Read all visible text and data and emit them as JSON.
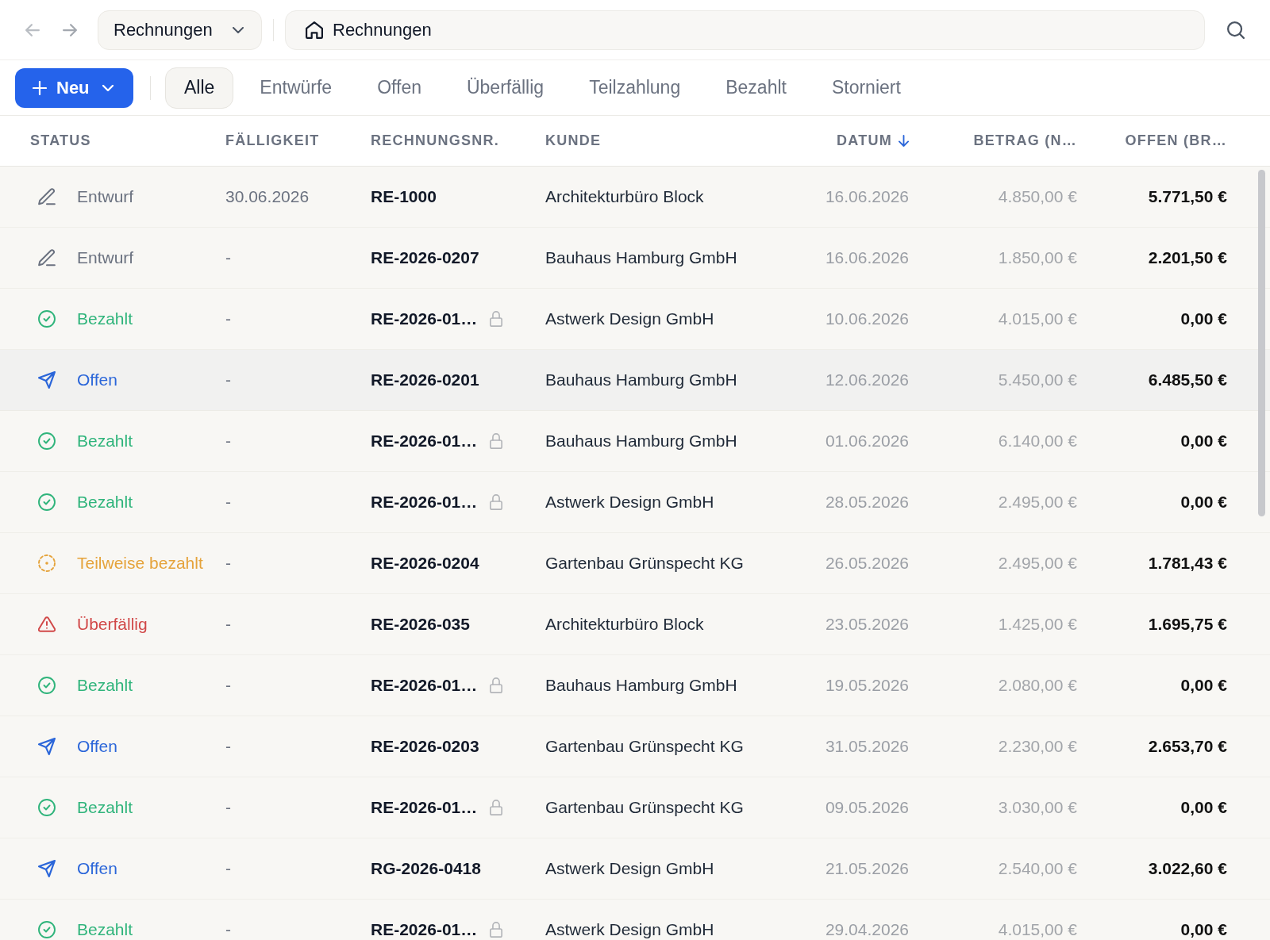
{
  "nav": {
    "section_dropdown": "Rechnungen",
    "breadcrumb": "Rechnungen"
  },
  "toolbar": {
    "new_button": "Neu",
    "tabs": [
      {
        "label": "Alle",
        "selected": true
      },
      {
        "label": "Entwürfe",
        "selected": false
      },
      {
        "label": "Offen",
        "selected": false
      },
      {
        "label": "Überfällig",
        "selected": false
      },
      {
        "label": "Teilzahlung",
        "selected": false
      },
      {
        "label": "Bezahlt",
        "selected": false
      },
      {
        "label": "Storniert",
        "selected": false
      }
    ]
  },
  "table": {
    "columns": [
      {
        "label": "STATUS",
        "sorted": false
      },
      {
        "label": "FÄLLIGKEIT",
        "sorted": false
      },
      {
        "label": "RECHNUNGSNR.",
        "sorted": false
      },
      {
        "label": "KUNDE",
        "sorted": false
      },
      {
        "label": "DATUM",
        "sorted": true
      },
      {
        "label": "BETRAG (N…",
        "sorted": false
      },
      {
        "label": "OFFEN (BR…",
        "sorted": false
      }
    ],
    "rows": [
      {
        "status": {
          "kind": "draft",
          "label": "Entwurf"
        },
        "due": "30.06.2026",
        "number": "RE-1000",
        "locked": false,
        "customer": "Architekturbüro Block",
        "date": "16.06.2026",
        "net": "4.850,00 €",
        "open": "5.771,50 €",
        "hovered": false
      },
      {
        "status": {
          "kind": "draft",
          "label": "Entwurf"
        },
        "due": "-",
        "number": "RE-2026-0207",
        "locked": false,
        "customer": "Bauhaus Hamburg GmbH",
        "date": "16.06.2026",
        "net": "1.850,00 €",
        "open": "2.201,50 €",
        "hovered": false
      },
      {
        "status": {
          "kind": "paid",
          "label": "Bezahlt"
        },
        "due": "-",
        "number": "RE-2026-01…",
        "locked": true,
        "customer": "Astwerk Design GmbH",
        "date": "10.06.2026",
        "net": "4.015,00 €",
        "open": "0,00 €",
        "hovered": false
      },
      {
        "status": {
          "kind": "sent",
          "label": "Offen"
        },
        "due": "-",
        "number": "RE-2026-0201",
        "locked": false,
        "customer": "Bauhaus Hamburg GmbH",
        "date": "12.06.2026",
        "net": "5.450,00 €",
        "open": "6.485,50 €",
        "hovered": true
      },
      {
        "status": {
          "kind": "paid",
          "label": "Bezahlt"
        },
        "due": "-",
        "number": "RE-2026-01…",
        "locked": true,
        "customer": "Bauhaus Hamburg GmbH",
        "date": "01.06.2026",
        "net": "6.140,00 €",
        "open": "0,00 €",
        "hovered": false
      },
      {
        "status": {
          "kind": "paid",
          "label": "Bezahlt"
        },
        "due": "-",
        "number": "RE-2026-01…",
        "locked": true,
        "customer": "Astwerk Design GmbH",
        "date": "28.05.2026",
        "net": "2.495,00 €",
        "open": "0,00 €",
        "hovered": false
      },
      {
        "status": {
          "kind": "partial",
          "label": "Teilweise bezahlt"
        },
        "due": "-",
        "number": "RE-2026-0204",
        "locked": false,
        "customer": "Gartenbau Grünspecht KG",
        "date": "26.05.2026",
        "net": "2.495,00 €",
        "open": "1.781,43 €",
        "hovered": false
      },
      {
        "status": {
          "kind": "overdue",
          "label": "Überfällig"
        },
        "due": "-",
        "number": "RE-2026-035",
        "locked": false,
        "customer": "Architekturbüro Block",
        "date": "23.05.2026",
        "net": "1.425,00 €",
        "open": "1.695,75 €",
        "hovered": false
      },
      {
        "status": {
          "kind": "paid",
          "label": "Bezahlt"
        },
        "due": "-",
        "number": "RE-2026-01…",
        "locked": true,
        "customer": "Bauhaus Hamburg GmbH",
        "date": "19.05.2026",
        "net": "2.080,00 €",
        "open": "0,00 €",
        "hovered": false
      },
      {
        "status": {
          "kind": "sent",
          "label": "Offen"
        },
        "due": "-",
        "number": "RE-2026-0203",
        "locked": false,
        "customer": "Gartenbau Grünspecht KG",
        "date": "31.05.2026",
        "net": "2.230,00 €",
        "open": "2.653,70 €",
        "hovered": false
      },
      {
        "status": {
          "kind": "paid",
          "label": "Bezahlt"
        },
        "due": "-",
        "number": "RE-2026-01…",
        "locked": true,
        "customer": "Gartenbau Grünspecht KG",
        "date": "09.05.2026",
        "net": "3.030,00 €",
        "open": "0,00 €",
        "hovered": false
      },
      {
        "status": {
          "kind": "sent",
          "label": "Offen"
        },
        "due": "-",
        "number": "RG-2026-0418",
        "locked": false,
        "customer": "Astwerk Design GmbH",
        "date": "21.05.2026",
        "net": "2.540,00 €",
        "open": "3.022,60 €",
        "hovered": false
      },
      {
        "status": {
          "kind": "paid",
          "label": "Bezahlt"
        },
        "due": "-",
        "number": "RE-2026-01…",
        "locked": true,
        "customer": "Astwerk Design GmbH",
        "date": "29.04.2026",
        "net": "4.015,00 €",
        "open": "0,00 €",
        "hovered": false
      }
    ]
  }
}
